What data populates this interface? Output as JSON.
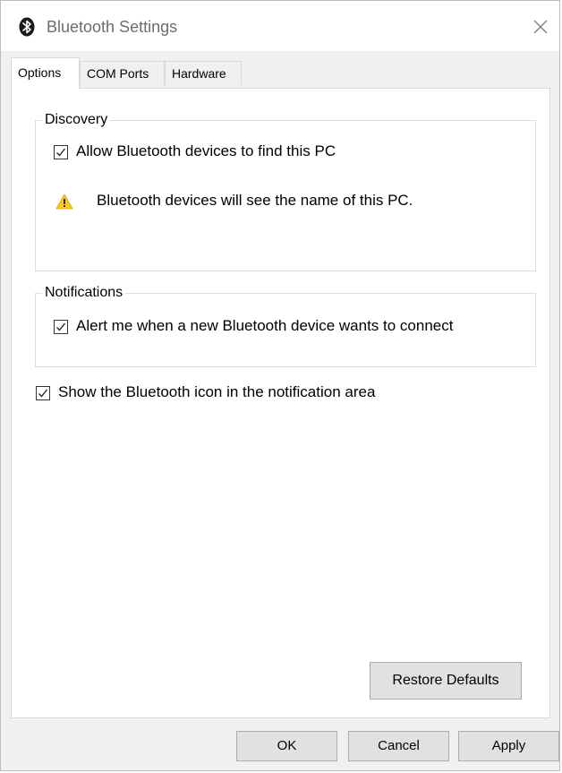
{
  "window": {
    "title": "Bluetooth Settings",
    "close_icon": "close-icon",
    "logo_icon": "bluetooth-icon"
  },
  "tabs": [
    {
      "label": "Options",
      "active": true
    },
    {
      "label": "COM Ports",
      "active": false
    },
    {
      "label": "Hardware",
      "active": false
    }
  ],
  "discovery": {
    "legend": "Discovery",
    "allow_label": "Allow Bluetooth devices to find this PC",
    "allow_checked": true,
    "warning_icon": "warning-icon",
    "warning_text": "Bluetooth devices will see the name of this PC."
  },
  "notifications": {
    "legend": "Notifications",
    "alert_label": "Alert me when a new Bluetooth device wants to connect",
    "alert_checked": true
  },
  "show_icon": {
    "label": "Show the Bluetooth icon in the notification area",
    "checked": true
  },
  "buttons": {
    "restore": "Restore Defaults",
    "ok": "OK",
    "cancel": "Cancel",
    "apply": "Apply"
  },
  "colors": {
    "accent_logo": "#1a1a1a",
    "warning_yellow": "#f7c72c",
    "panel_bg": "#ffffff",
    "window_bg": "#f0f0f0"
  }
}
